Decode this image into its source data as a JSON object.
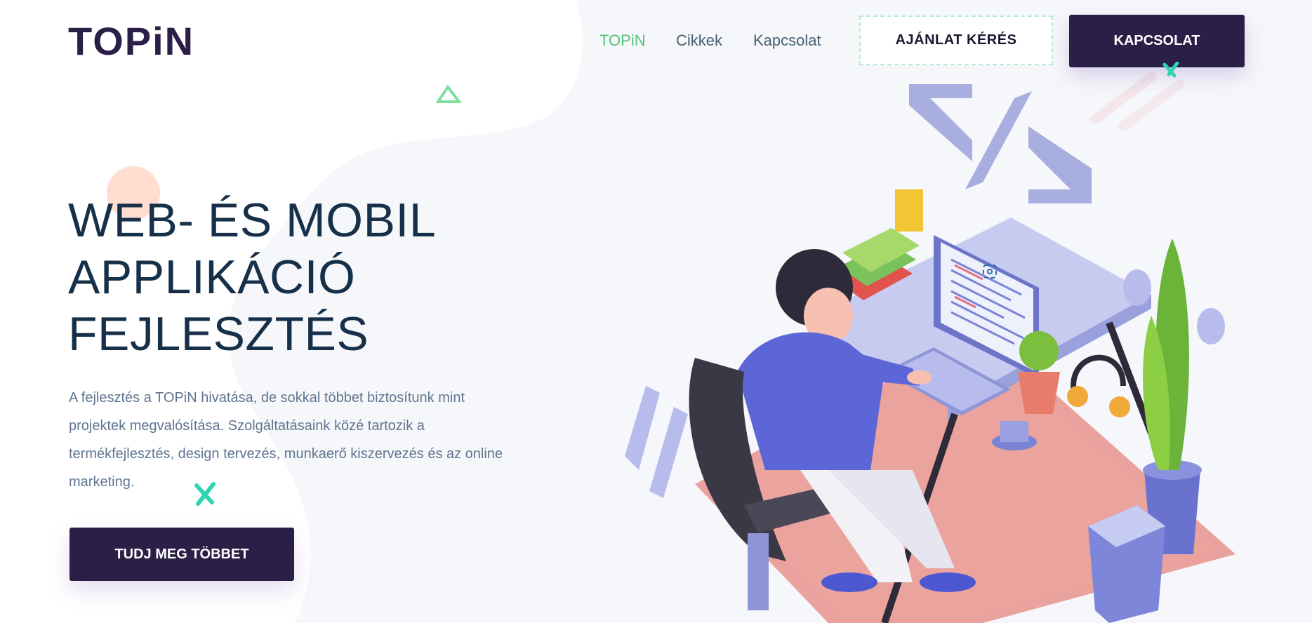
{
  "brand": {
    "logo_text": "TOPiN"
  },
  "nav": {
    "links": [
      {
        "label": "TOPiN",
        "active": true
      },
      {
        "label": "Cikkek",
        "active": false
      },
      {
        "label": "Kapcsolat",
        "active": false
      }
    ],
    "quote_button": "AJÁNLAT KÉRÉS",
    "contact_button": "KAPCSOLAT"
  },
  "hero": {
    "title_lines": [
      "WEB- ÉS MOBIL",
      "APPLIKÁCIÓ",
      "FEJLESZTÉS"
    ],
    "description_lines": [
      "A fejlesztés a TOPiN hivatása, de sokkal többet biztosítunk mint",
      "projektek megvalósítása. Szolgáltatásaink közé tartozik a",
      "termékfejlesztés, design tervezés, munkaerő kiszervezés és az online",
      "marketing."
    ],
    "cta_button": "TUDJ MEG TÖBBET"
  },
  "colors": {
    "primary": "#2b1f47",
    "accent_green": "#55c27b",
    "title": "#173049",
    "text": "#5f7590"
  }
}
